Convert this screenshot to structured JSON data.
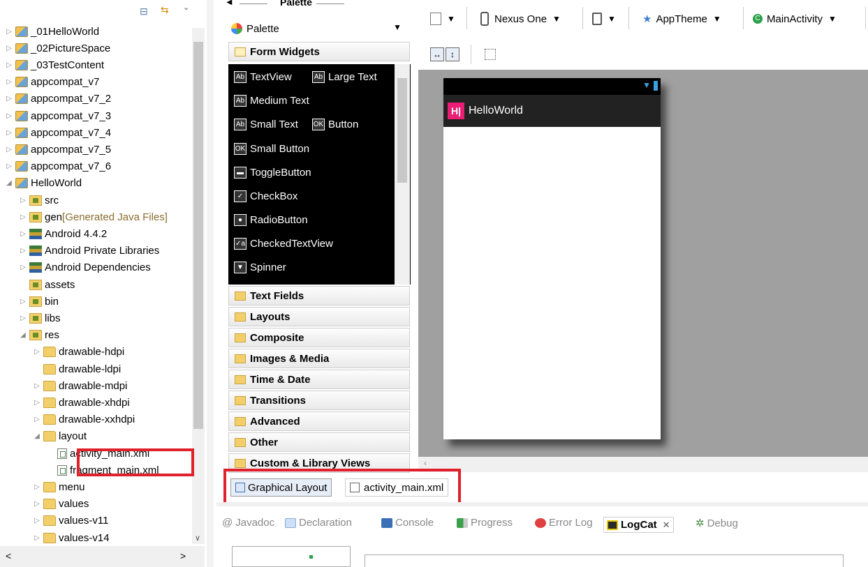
{
  "tree": {
    "items": [
      {
        "label": "_01HelloWorld",
        "arrow": "▷",
        "icon": "proj",
        "indent": 0
      },
      {
        "label": "_02PictureSpace",
        "arrow": "▷",
        "icon": "proj",
        "indent": 0
      },
      {
        "label": "_03TestContent",
        "arrow": "▷",
        "icon": "proj",
        "indent": 0
      },
      {
        "label": "appcompat_v7",
        "arrow": "▷",
        "icon": "proj",
        "indent": 0
      },
      {
        "label": "appcompat_v7_2",
        "arrow": "▷",
        "icon": "proj",
        "indent": 0
      },
      {
        "label": "appcompat_v7_3",
        "arrow": "▷",
        "icon": "proj",
        "indent": 0
      },
      {
        "label": "appcompat_v7_4",
        "arrow": "▷",
        "icon": "proj",
        "indent": 0
      },
      {
        "label": "appcompat_v7_5",
        "arrow": "▷",
        "icon": "proj",
        "indent": 0
      },
      {
        "label": "appcompat_v7_6",
        "arrow": "▷",
        "icon": "proj",
        "indent": 0
      },
      {
        "label": "HelloWorld",
        "arrow": "◢",
        "icon": "proj",
        "indent": 0
      },
      {
        "label": "src",
        "arrow": "▷",
        "icon": "pkgf",
        "indent": 1
      },
      {
        "label": "gen",
        "suffix": " [Generated Java Files]",
        "arrow": "▷",
        "icon": "pkgf",
        "indent": 1
      },
      {
        "label": "Android 4.4.2",
        "arrow": "▷",
        "icon": "lib",
        "indent": 1
      },
      {
        "label": "Android Private Libraries",
        "arrow": "▷",
        "icon": "lib",
        "indent": 1
      },
      {
        "label": "Android Dependencies",
        "arrow": "▷",
        "icon": "lib",
        "indent": 1
      },
      {
        "label": "assets",
        "arrow": "",
        "icon": "pkgf",
        "indent": 1
      },
      {
        "label": "bin",
        "arrow": "▷",
        "icon": "pkgf",
        "indent": 1
      },
      {
        "label": "libs",
        "arrow": "▷",
        "icon": "pkgf",
        "indent": 1
      },
      {
        "label": "res",
        "arrow": "◢",
        "icon": "pkgf",
        "indent": 1
      },
      {
        "label": "drawable-hdpi",
        "arrow": "▷",
        "icon": "fold",
        "indent": 2
      },
      {
        "label": "drawable-ldpi",
        "arrow": "",
        "icon": "fold",
        "indent": 2
      },
      {
        "label": "drawable-mdpi",
        "arrow": "▷",
        "icon": "fold",
        "indent": 2
      },
      {
        "label": "drawable-xhdpi",
        "arrow": "▷",
        "icon": "fold",
        "indent": 2
      },
      {
        "label": "drawable-xxhdpi",
        "arrow": "▷",
        "icon": "fold",
        "indent": 2
      },
      {
        "label": "layout",
        "arrow": "◢",
        "icon": "fold",
        "indent": 2
      },
      {
        "label": "activity_main.xml",
        "arrow": "",
        "icon": "xmlf",
        "indent": 3
      },
      {
        "label": "fragment_main.xml",
        "arrow": "",
        "icon": "xmlf",
        "indent": 3
      },
      {
        "label": "menu",
        "arrow": "▷",
        "icon": "fold",
        "indent": 2
      },
      {
        "label": "values",
        "arrow": "▷",
        "icon": "fold",
        "indent": 2
      },
      {
        "label": "values-v11",
        "arrow": "▷",
        "icon": "fold",
        "indent": 2
      },
      {
        "label": "values-v14",
        "arrow": "▷",
        "icon": "fold",
        "indent": 2
      }
    ],
    "scroll_left": "<",
    "scroll_right": ">"
  },
  "palette": {
    "header": "Palette",
    "dropdown": "Palette",
    "open_category": "Form Widgets",
    "widgets": [
      {
        "label": "TextView",
        "icon": "Ab"
      },
      {
        "label": "Large Text",
        "icon": "Ab"
      },
      {
        "label": "Medium Text",
        "icon": "Ab"
      },
      {
        "label": "Small Text",
        "icon": "Ab"
      },
      {
        "label": "Button",
        "icon": "OK"
      },
      {
        "label": "Small Button",
        "icon": "OK"
      },
      {
        "label": "ToggleButton",
        "icon": "▬"
      },
      {
        "label": "CheckBox",
        "icon": "✓"
      },
      {
        "label": "RadioButton",
        "icon": "●"
      },
      {
        "label": "CheckedTextView",
        "icon": "✓a"
      },
      {
        "label": "Spinner",
        "icon": "▼"
      }
    ],
    "categories": [
      "Text Fields",
      "Layouts",
      "Composite",
      "Images & Media",
      "Time & Date",
      "Transitions",
      "Advanced",
      "Other",
      "Custom & Library Views"
    ]
  },
  "toolbar": {
    "device": "Nexus One",
    "theme": "AppTheme",
    "activity": "MainActivity"
  },
  "preview": {
    "app_title": "HelloWorld",
    "logo": "H|"
  },
  "editor_tabs": [
    "Graphical Layout",
    "activity_main.xml"
  ],
  "bottom_tabs": [
    "Javadoc",
    "Declaration",
    "Console",
    "Progress",
    "Error Log",
    "LogCat",
    "Debug"
  ],
  "logcat_close": "✕",
  "colors": {
    "highlight": "#e0202a",
    "preview_bg": "#a0a0a0",
    "logo": "#e91e74"
  }
}
